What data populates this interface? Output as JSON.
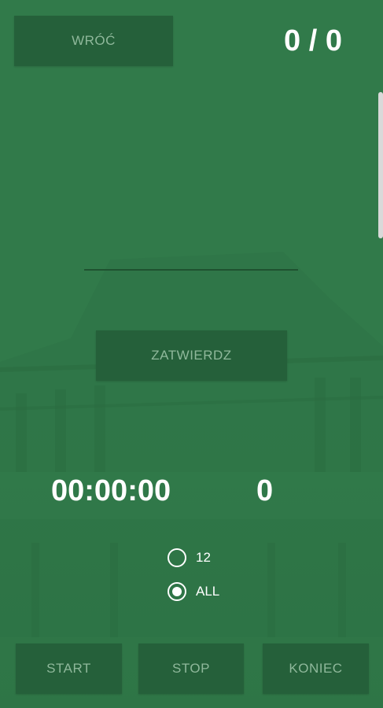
{
  "header": {
    "back_label": "WRÓĆ",
    "score": "0 / 0"
  },
  "answer": {
    "value": "",
    "placeholder": ""
  },
  "submit_label": "ZATWIERDZ",
  "stats": {
    "timer": "00:00:00",
    "count": "0"
  },
  "mode_options": [
    {
      "label": "12",
      "selected": false
    },
    {
      "label": "ALL",
      "selected": true
    }
  ],
  "footer": {
    "start_label": "START",
    "stop_label": "STOP",
    "end_label": "KONIEC"
  },
  "colors": {
    "background": "#317a4a",
    "button": "#25603a",
    "button_text": "#8fb89b",
    "text": "#ffffff"
  }
}
